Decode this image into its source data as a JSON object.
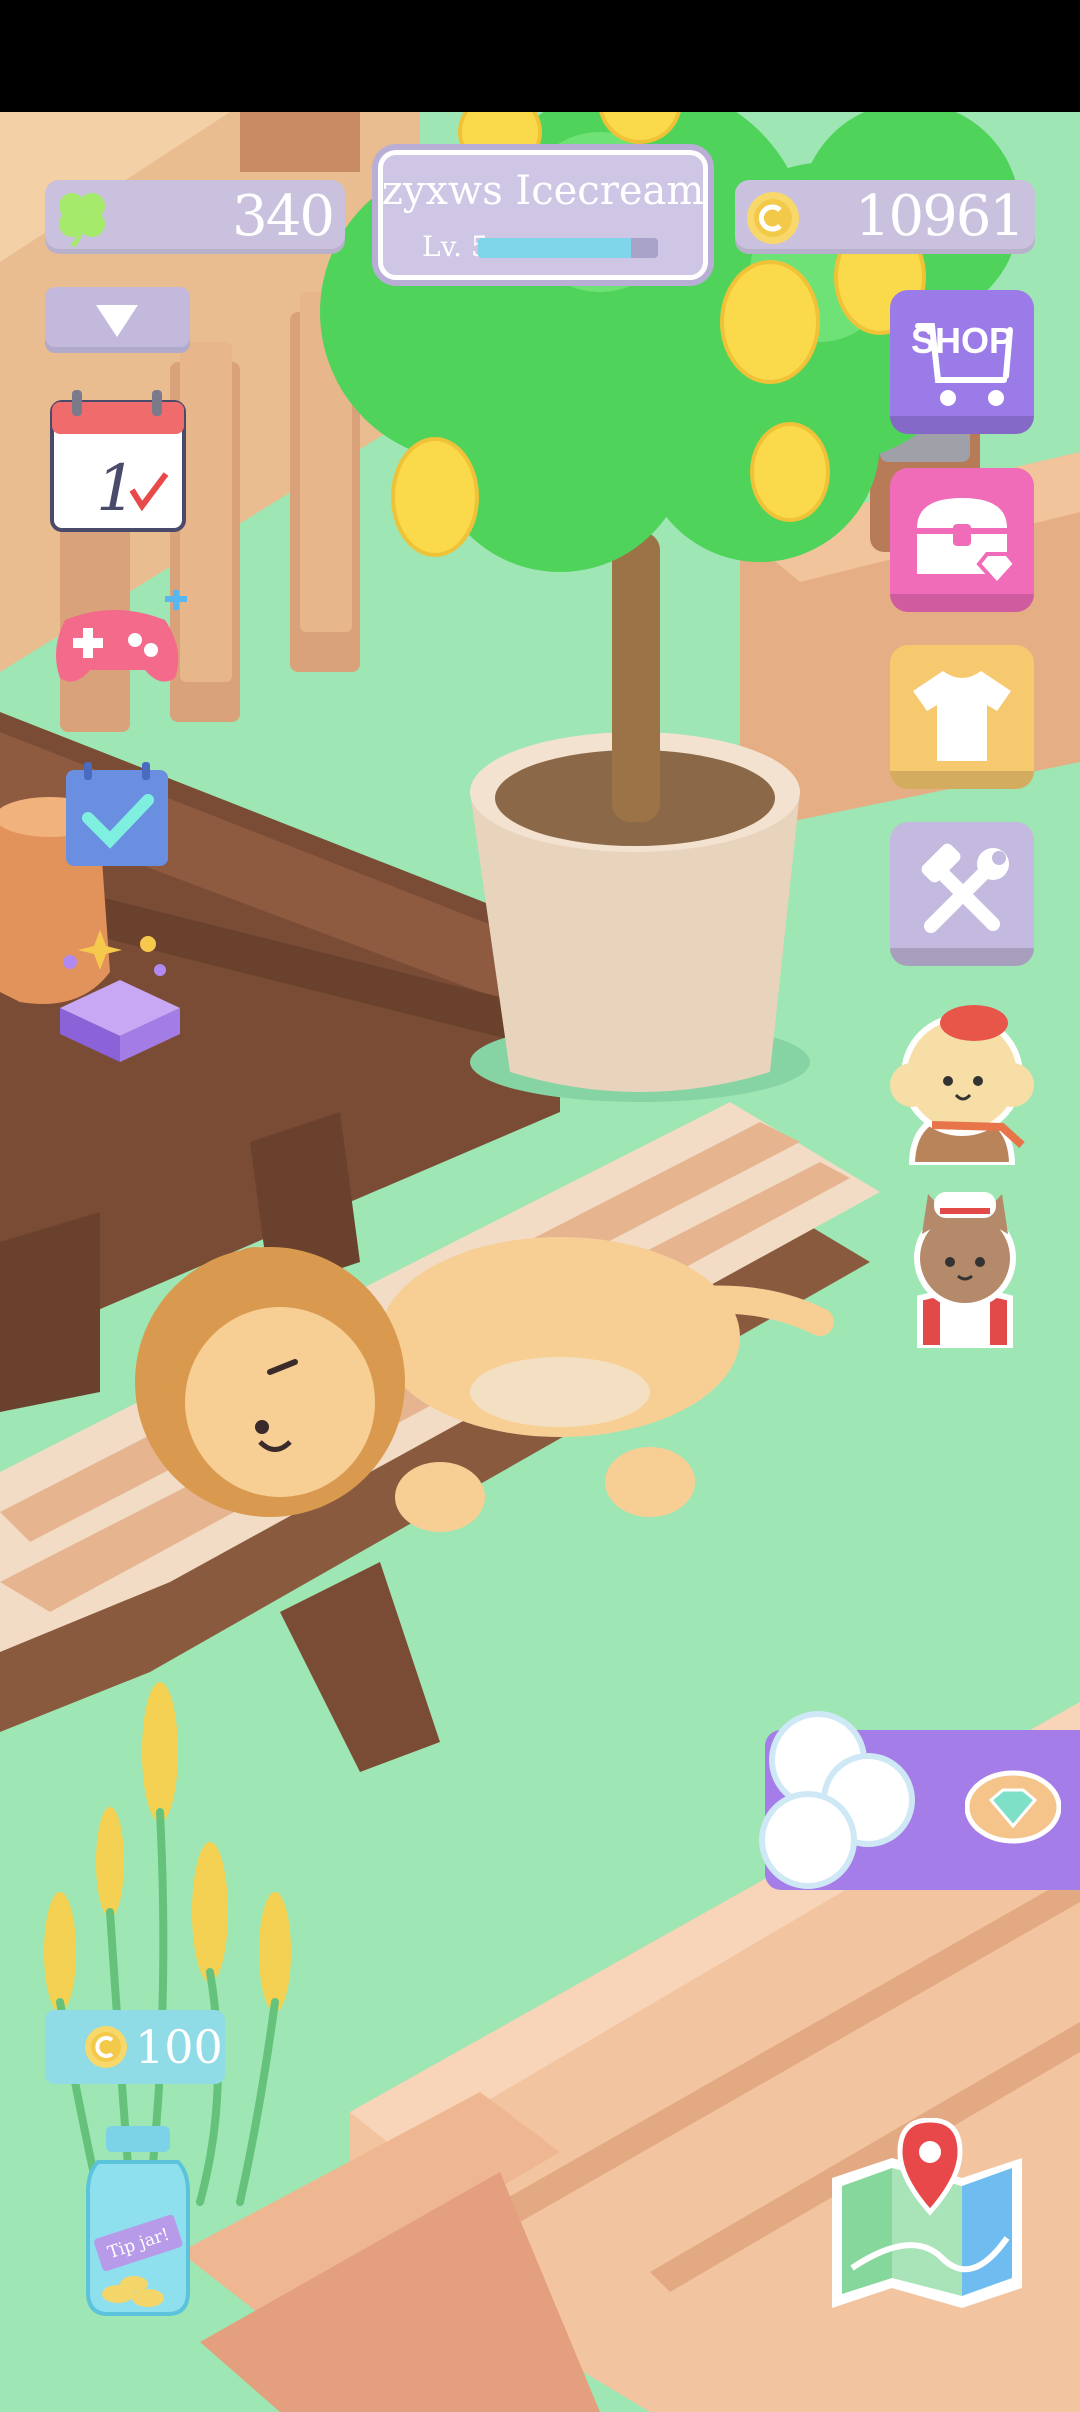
{
  "hud": {
    "clovers": "340",
    "coins": "10961",
    "player_name": "zyxws Icecream",
    "level": "Lv. 5",
    "xp_progress": 0.85
  },
  "side_buttons": {
    "shop_label": "SHOP"
  },
  "tip_jar": {
    "amount": "100",
    "jar_label": "Tip jar!"
  },
  "icons": [
    "clover-icon",
    "coin-icon",
    "dropdown-arrow-icon",
    "calendar-icon",
    "gamepad-plus-icon",
    "checklist-icon",
    "gift-box-icon",
    "shop-cart-icon",
    "treasure-chest-icon",
    "shirt-icon",
    "tools-icon",
    "poodle-customer-icon",
    "cat-chef-icon",
    "diamond-icon",
    "map-icon",
    "tip-jar-icon"
  ],
  "calendar_day": "1",
  "colors": {
    "grass": "#9ee6b3",
    "hud_pill": "#c9c1dd",
    "shop": "#9a7be8",
    "chest": "#f06cb8",
    "shirt": "#f7c96f",
    "tools": "#c4b9de",
    "offer": "#a57de8"
  }
}
